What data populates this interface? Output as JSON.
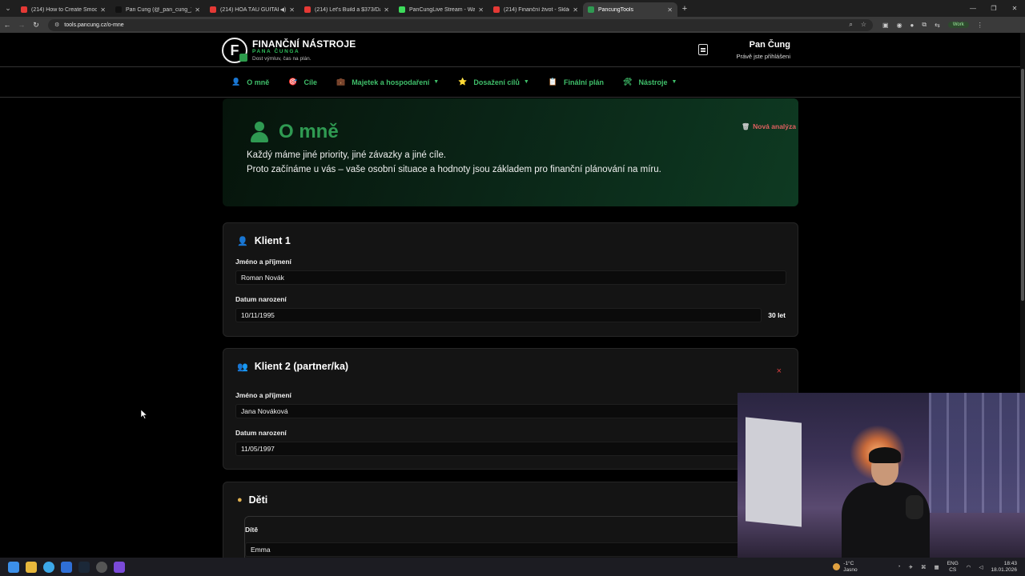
{
  "browser": {
    "tabs": [
      {
        "title": "(214) How to Create Smooth Sh",
        "favicon_color": "#e53935"
      },
      {
        "title": "Pan Čung (@_pan_cung_) vysíl",
        "favicon_color": "#111111"
      },
      {
        "title": "(214) HÒA TẤU GUITAR HA",
        "favicon_color": "#e53935"
      },
      {
        "title": "(214) Let's Build a $373/Day Bu",
        "favicon_color": "#e53935"
      },
      {
        "title": "PanCungLive Stream - Watch Li",
        "favicon_color": "#3ddc5b"
      },
      {
        "title": "(214) Finanční život - Skládání",
        "favicon_color": "#e53935"
      },
      {
        "title": "PancungTools",
        "favicon_color": "#2f9a52"
      }
    ],
    "url": "tools.pancung.cz/o-mne",
    "profile_label": "Work"
  },
  "header": {
    "logo_letter": "F",
    "logo_title": "FINANČNÍ NÁSTROJE",
    "logo_subtitle": "PANA ČUNGA",
    "logo_tagline": "Dost výmluv, čas na plán.",
    "user_name": "Pan Čung",
    "user_status": "Právě jste přihlášeni"
  },
  "menu": [
    {
      "label": "O mně",
      "icon": "👤",
      "dropdown": false
    },
    {
      "label": "Cíle",
      "icon": "🎯",
      "dropdown": false
    },
    {
      "label": "Majetek a hospodaření",
      "icon": "💼",
      "dropdown": true
    },
    {
      "label": "Dosažení cílů",
      "icon": "⭐",
      "dropdown": true
    },
    {
      "label": "Finální plán",
      "icon": "📋",
      "dropdown": false
    },
    {
      "label": "Nástroje",
      "icon": "🛠",
      "dropdown": true
    }
  ],
  "hero": {
    "title": "O mně",
    "line1": "Každý máme jiné priority, jiné závazky a jiné cíle.",
    "line2": "Proto začínáme u vás – vaše osobní situace a hodnoty jsou základem pro finanční plánování na míru.",
    "new_analysis": "Nová analýza"
  },
  "client1": {
    "title": "Klient 1",
    "name_label": "Jméno a příjmení",
    "name_value": "Roman Novák",
    "dob_label": "Datum narození",
    "dob_value": "10/11/1995",
    "age": "30 let"
  },
  "client2": {
    "title": "Klient 2 (partner/ka)",
    "name_label": "Jméno a příjmení",
    "name_value": "Jana Nováková",
    "dob_label": "Datum narození",
    "dob_value": "11/05/1997",
    "remove_symbol": "×"
  },
  "children": {
    "title": "Děti",
    "child_label": "Dítě",
    "child_name": "Emma"
  },
  "taskbar": {
    "temperature": "-1°C",
    "weather": "Jasno",
    "lang1": "ENG",
    "lang2": "CS",
    "time": "18:43",
    "date": "18.01.2026"
  }
}
